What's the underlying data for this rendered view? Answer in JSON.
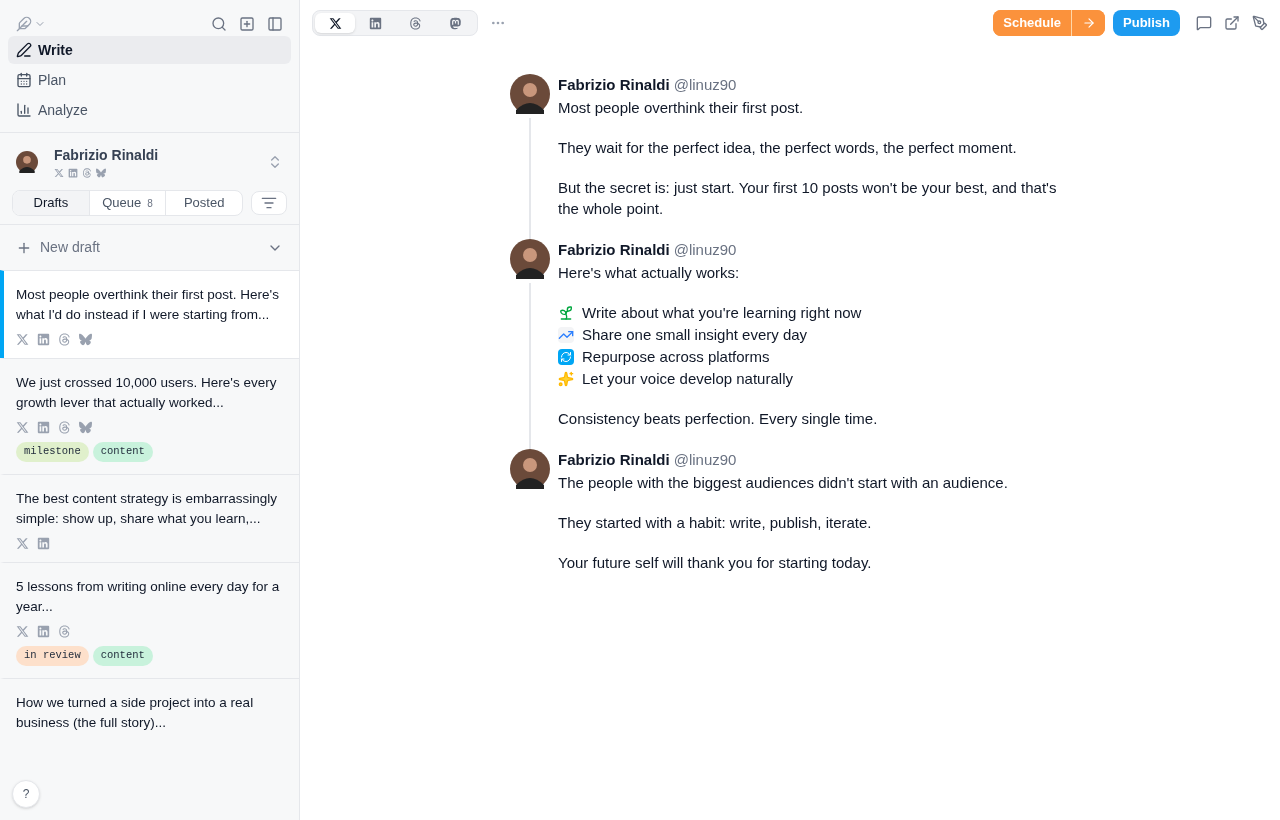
{
  "nav": [
    {
      "label": "Write",
      "kind": "pen",
      "selected": true
    },
    {
      "label": "Plan",
      "kind": "calendar",
      "selected": false
    },
    {
      "label": "Analyze",
      "kind": "chart",
      "selected": false
    }
  ],
  "account": {
    "name": "Fabrizio Rinaldi",
    "platforms": [
      {
        "kind": "x"
      },
      {
        "kind": "linkedin"
      },
      {
        "kind": "threads"
      },
      {
        "kind": "bluesky"
      }
    ]
  },
  "draft_tabs": [
    {
      "label": "Drafts",
      "selected": true
    },
    {
      "label": "Queue",
      "count": "8",
      "selected": false
    },
    {
      "label": "Posted",
      "selected": false
    }
  ],
  "new_draft": {
    "label": "New draft"
  },
  "drafts": [
    {
      "text": "Most people overthink their first post. Here's what I'd do instead if I were starting from...",
      "platforms": [
        {
          "kind": "x"
        },
        {
          "kind": "linkedin"
        },
        {
          "kind": "threads"
        },
        {
          "kind": "bluesky"
        }
      ],
      "selected": true
    },
    {
      "text": "We just crossed 10,000 users. Here's every growth lever that actually worked...",
      "platforms": [
        {
          "kind": "x"
        },
        {
          "kind": "linkedin"
        },
        {
          "kind": "threads"
        },
        {
          "kind": "bluesky"
        }
      ],
      "tags": [
        {
          "label": "milestone",
          "color": "#e0f0cc"
        },
        {
          "label": "content",
          "color": "#c8f2dc"
        }
      ],
      "selected": false
    },
    {
      "text": "The best content strategy is embarrassingly simple: show up, share what you learn,...",
      "platforms": [
        {
          "kind": "x"
        },
        {
          "kind": "linkedin"
        }
      ],
      "selected": false
    },
    {
      "text": "5 lessons from writing online every day for a year...",
      "platforms": [
        {
          "kind": "x"
        },
        {
          "kind": "linkedin"
        },
        {
          "kind": "threads"
        }
      ],
      "tags": [
        {
          "label": "in review",
          "color": "#fde0cb"
        },
        {
          "label": "content",
          "color": "#c8f2dc"
        }
      ],
      "selected": false
    },
    {
      "text": "How we turned a side project into a real business (the full story)...",
      "selected": false
    }
  ],
  "help": {
    "label": "?"
  },
  "platform_tabs": [
    {
      "kind": "x",
      "selected": true
    },
    {
      "kind": "linkedin",
      "selected": false
    },
    {
      "kind": "threads",
      "selected": false
    },
    {
      "kind": "mastodon",
      "selected": false
    }
  ],
  "actions": {
    "schedule": "Schedule",
    "publish": "Publish"
  },
  "posts": [
    {
      "author": "Fabrizio Rinaldi",
      "handle": "@linuz90",
      "blocks": [
        {
          "kind": "paragraph",
          "text": "Most people overthink their first post."
        },
        {
          "kind": "paragraph",
          "text": "They wait for the perfect idea, the perfect words, the perfect moment."
        },
        {
          "kind": "paragraph",
          "text": "But the secret is: just start. Your first 10 posts won't be your best, and that's the whole point."
        }
      ]
    },
    {
      "author": "Fabrizio Rinaldi",
      "handle": "@linuz90",
      "blocks": [
        {
          "kind": "paragraph",
          "text": "Here's what actually works:"
        },
        {
          "kind": "list",
          "items": [
            {
              "kind": "sprout",
              "text": "Write about what you're learning right now"
            },
            {
              "kind": "chart",
              "text": "Share one small insight every day"
            },
            {
              "kind": "repeat",
              "text": "Repurpose across platforms"
            },
            {
              "kind": "sparkles",
              "text": "Let your voice develop naturally"
            }
          ]
        },
        {
          "kind": "paragraph",
          "text": "Consistency beats perfection. Every single time."
        }
      ]
    },
    {
      "author": "Fabrizio Rinaldi",
      "handle": "@linuz90",
      "blocks": [
        {
          "kind": "paragraph",
          "text": "The people with the biggest audiences didn't start with an audience."
        },
        {
          "kind": "paragraph",
          "text": "They started with a habit: write, publish, iterate."
        },
        {
          "kind": "paragraph",
          "text": "Your future self will thank you for starting today."
        }
      ]
    }
  ]
}
